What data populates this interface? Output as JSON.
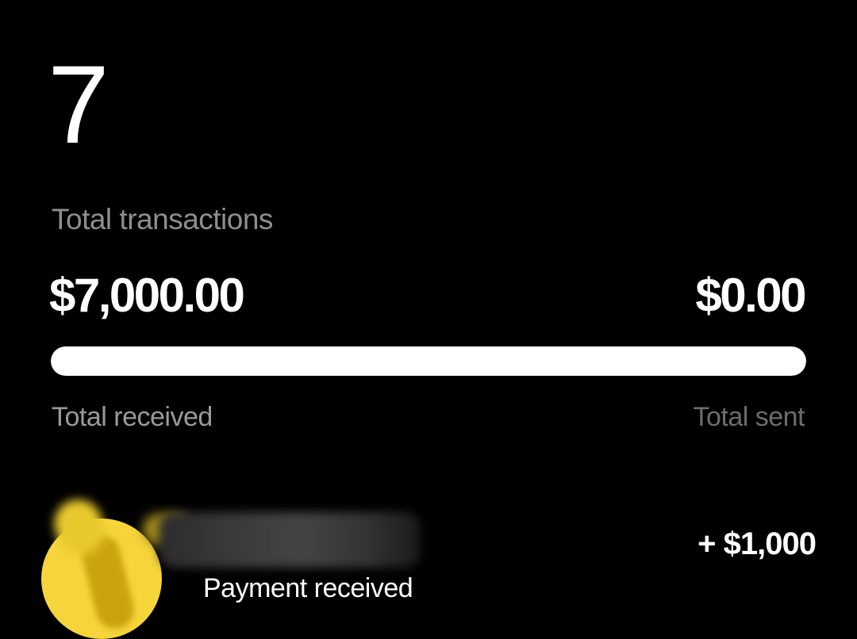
{
  "summary": {
    "transaction_count": "7",
    "transaction_count_label": "Total transactions",
    "total_received": "$7,000.00",
    "total_sent": "$0.00",
    "total_received_label": "Total received",
    "total_sent_label": "Total sent",
    "received_share": 1.0
  },
  "transactions": [
    {
      "subtitle": "Payment received",
      "amount": "+ $1,000",
      "avatar_color": "#f6d53a",
      "avatar_icon": "user-avatar-icon"
    }
  ],
  "colors": {
    "background": "#000000",
    "primary_text": "#ffffff",
    "secondary_text": "#8e8e8e",
    "bar_fill": "#ffffff",
    "avatar_yellow": "#f6d53a"
  }
}
